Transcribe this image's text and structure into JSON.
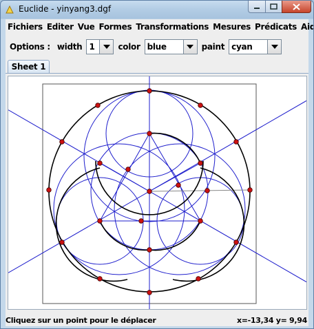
{
  "window": {
    "title": "Euclide - yinyang3.dgf",
    "min_icon": "minimize-icon",
    "max_icon": "maximize-icon",
    "close_icon": "close-icon"
  },
  "menu": [
    "Fichiers",
    "Editer",
    "Vue",
    "Formes",
    "Transformations",
    "Mesures",
    "Prédicats",
    "Aide"
  ],
  "toolbar": {
    "options_label": "Options :",
    "width_label": "width",
    "width_value": "1",
    "color_label": "color",
    "color_value": "blue",
    "paint_label": "paint",
    "paint_value": "cyan"
  },
  "tabs": [
    "Sheet 1"
  ],
  "status": {
    "message": "Cliquez sur un point pour le déplacer",
    "coords": "x=-13,34 y=  9,94"
  },
  "colors": {
    "construction": "#1d1dcc",
    "curve": "#000000",
    "point": "#cc1111"
  }
}
